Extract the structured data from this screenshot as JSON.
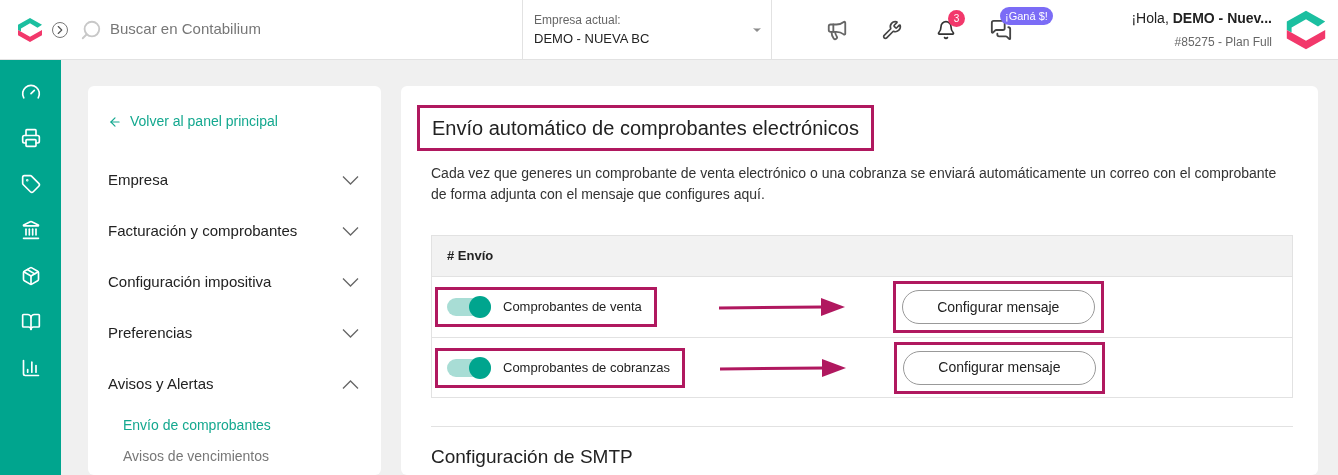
{
  "header": {
    "search": {
      "placeholder": "Buscar en Contabilium"
    },
    "company": {
      "label": "Empresa actual:",
      "value": "DEMO - NUEVA BC"
    },
    "notifications": {
      "count": "3"
    },
    "promo_badge": "¡Ganá $!",
    "greeting": "¡Hola, **DEMO - Nuev...**",
    "plan": "#85275 - Plan Full"
  },
  "settings_menu": {
    "back_link": "Volver al panel principal",
    "sections": [
      {
        "label": "Empresa",
        "expanded": false
      },
      {
        "label": "Facturación y comprobantes",
        "expanded": false
      },
      {
        "label": "Configuración impositiva",
        "expanded": false
      },
      {
        "label": "Preferencias",
        "expanded": false
      },
      {
        "label": "Avisos y Alertas",
        "expanded": true,
        "children": [
          {
            "label": "Envío de comprobantes",
            "selected": true
          },
          {
            "label": "Avisos de vencimientos",
            "selected": false
          }
        ]
      }
    ]
  },
  "content": {
    "title": "Envío automático de comprobantes electrónicos",
    "title_highlighted": true,
    "description": "Cada vez que generes un comprobante de venta electrónico o una cobranza se enviará automáticamente un correo con el comprobante de forma adjunta con el mensaje que configures aquí.",
    "table": {
      "column_header": "# Envío",
      "rows": [
        {
          "label": "Comprobantes de venta",
          "on": true,
          "button": "Configurar mensaje",
          "highlighted": true
        },
        {
          "label": "Comprobantes de cobranzas",
          "on": true,
          "button": "Configurar mensaje",
          "highlighted": true
        }
      ]
    },
    "smtp_heading": "Configuración de SMTP"
  }
}
